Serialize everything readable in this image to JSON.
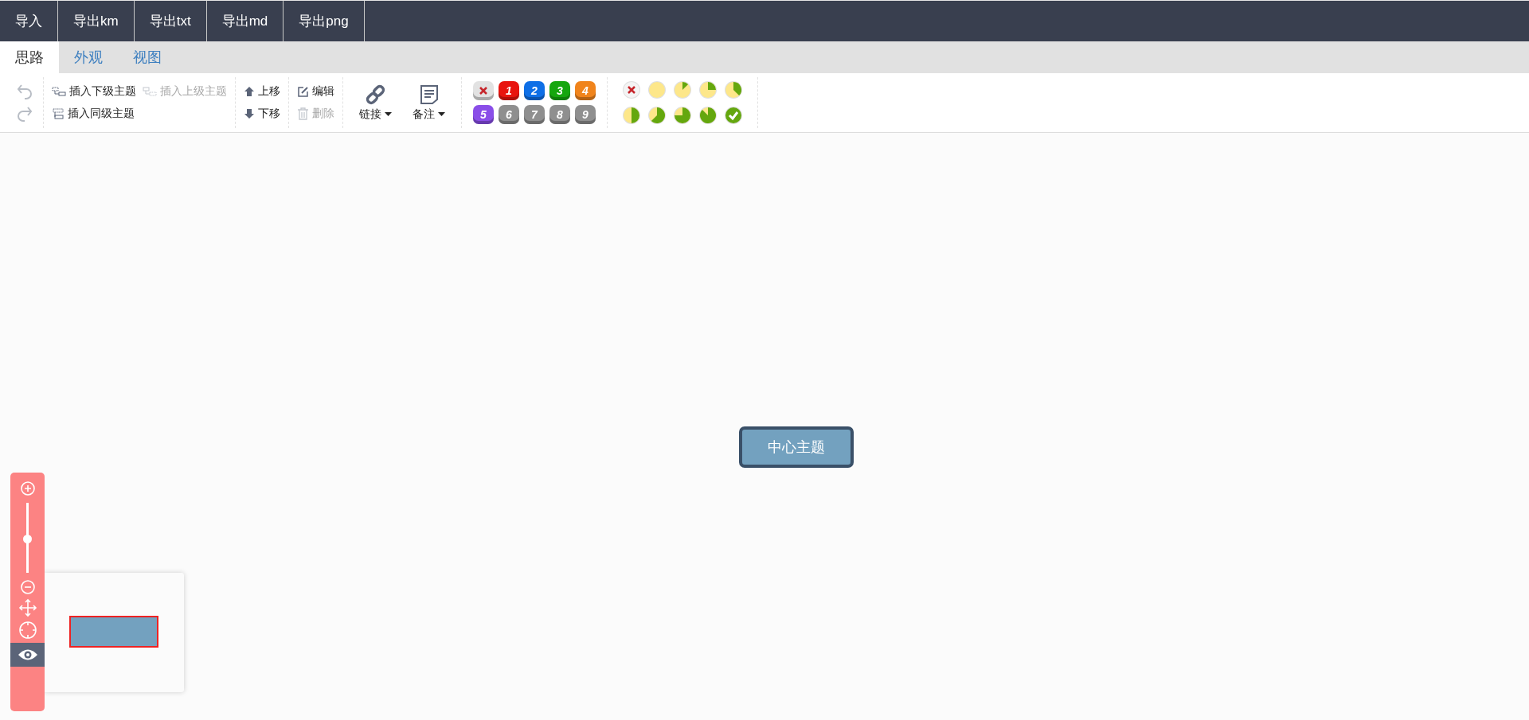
{
  "menu": [
    "导入",
    "导出km",
    "导出txt",
    "导出md",
    "导出png"
  ],
  "tabs": [
    {
      "label": "思路",
      "selected": true
    },
    {
      "label": "外观",
      "selected": false
    },
    {
      "label": "视图",
      "selected": false
    }
  ],
  "toolbar": {
    "history": [
      {
        "kind": "undo",
        "disabled": true
      },
      {
        "kind": "redo",
        "disabled": true
      }
    ],
    "insert": [
      {
        "kind": "child",
        "label": "插入下级主题",
        "disabled": false
      },
      {
        "kind": "parent",
        "label": "插入上级主题",
        "disabled": true
      },
      {
        "kind": "sibling",
        "label": "插入同级主题",
        "disabled": false
      }
    ],
    "move": [
      {
        "kind": "up",
        "label": "上移",
        "disabled": false
      },
      {
        "kind": "down",
        "label": "下移",
        "disabled": false
      }
    ],
    "edit": [
      {
        "kind": "edit",
        "label": "编辑",
        "disabled": false
      },
      {
        "kind": "delete",
        "label": "删除",
        "disabled": true
      }
    ],
    "attach": [
      {
        "kind": "link",
        "label": "链接"
      },
      {
        "kind": "note",
        "label": "备注"
      }
    ],
    "priority": [
      {
        "kind": "clear",
        "color": "#e2e2e2"
      },
      {
        "kind": "number",
        "label": "1",
        "color": "#e8140f"
      },
      {
        "kind": "number",
        "label": "2",
        "color": "#0e6fe6"
      },
      {
        "kind": "number",
        "label": "3",
        "color": "#15a60e"
      },
      {
        "kind": "number",
        "label": "4",
        "color": "#f0841c"
      },
      {
        "kind": "number",
        "label": "5",
        "color": "#8a4ee8"
      },
      {
        "kind": "number",
        "label": "6",
        "color": "#8f8f8f"
      },
      {
        "kind": "number",
        "label": "7",
        "color": "#8f8f8f"
      },
      {
        "kind": "number",
        "label": "8",
        "color": "#8f8f8f"
      },
      {
        "kind": "number",
        "label": "9",
        "color": "#8f8f8f"
      }
    ],
    "progress": [
      {
        "kind": "clear"
      },
      {
        "kind": "empty"
      },
      {
        "kind": "eighth"
      },
      {
        "kind": "quarter"
      },
      {
        "kind": "three-eighths"
      },
      {
        "kind": "half"
      },
      {
        "kind": "five-eighths"
      },
      {
        "kind": "three-quarters"
      },
      {
        "kind": "seven-eighths"
      },
      {
        "kind": "done"
      }
    ]
  },
  "canvas": {
    "root_topic": "中心主题"
  },
  "navigator": {
    "zoom": {
      "level": 0.48
    },
    "preview_on": true
  }
}
